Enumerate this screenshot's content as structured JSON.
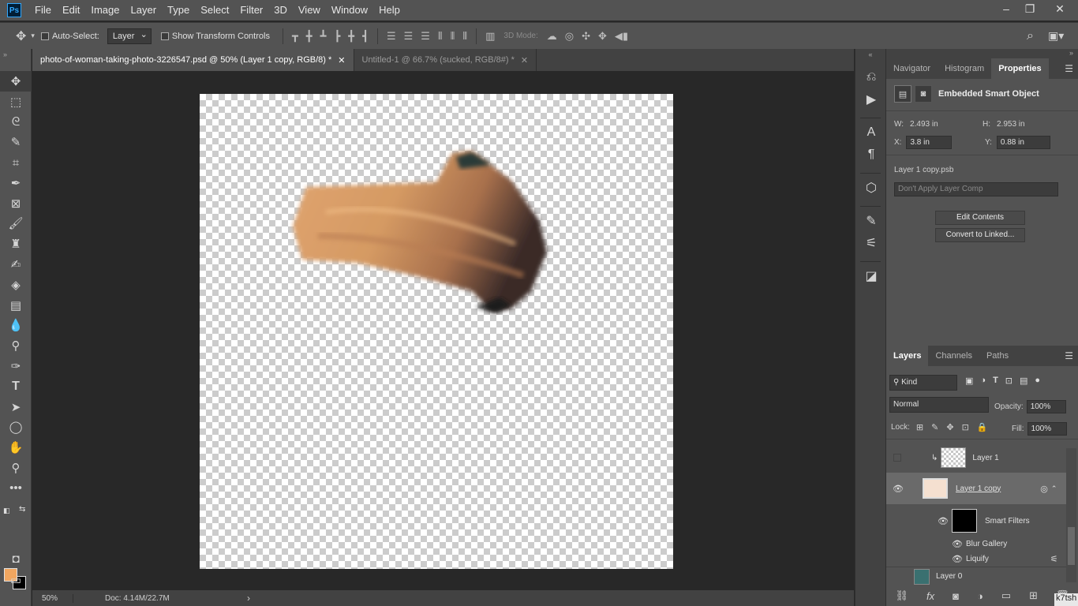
{
  "app": {
    "logo": "Ps",
    "menu": [
      "File",
      "Edit",
      "Image",
      "Layer",
      "Type",
      "Select",
      "Filter",
      "3D",
      "View",
      "Window",
      "Help"
    ],
    "window_controls": {
      "minimize": "–",
      "restore": "❐",
      "close": "✕"
    }
  },
  "options": {
    "auto_select_label": "Auto-Select:",
    "auto_select_value": "Layer",
    "transform_label": "Show Transform Controls",
    "mode_3d_label": "3D Mode:"
  },
  "tabs": [
    {
      "label": "photo-of-woman-taking-photo-3226547.psd @ 50% (Layer 1 copy, RGB/8) *",
      "close": "✕"
    },
    {
      "label": "Untitled-1 @ 66.7% (sucked, RGB/8#) *",
      "close": "✕"
    }
  ],
  "status": {
    "zoom": "50%",
    "doc": "Doc: 4.14M/22.7M",
    "arrow": "›"
  },
  "colors": {
    "foreground": "#f0a660",
    "background": "#000000",
    "accent": "#31a8ff"
  },
  "properties": {
    "tabs": [
      "Navigator",
      "Histogram",
      "Properties"
    ],
    "title": "Embedded Smart Object",
    "w_label": "W:",
    "w_value": "2.493 in",
    "h_label": "H:",
    "h_value": "2.953 in",
    "x_label": "X:",
    "x_value": "3.8 in",
    "y_label": "Y:",
    "y_value": "0.88 in",
    "file": "Layer 1 copy.psb",
    "layer_comp": "Don't Apply Layer Comp",
    "edit_contents": "Edit Contents",
    "convert": "Convert to Linked..."
  },
  "layers": {
    "tabs": [
      "Layers",
      "Channels",
      "Paths"
    ],
    "kind": "Kind",
    "blend_mode": "Normal",
    "opacity_label": "Opacity:",
    "opacity_value": "100%",
    "lock_label": "Lock:",
    "fill_label": "Fill:",
    "fill_value": "100%",
    "items": {
      "layer1": "Layer 1",
      "layer1copy": "Layer 1 copy",
      "smart_filters": "Smart Filters",
      "blur_gallery": "Blur Gallery",
      "liquify": "Liquify",
      "layer0": "Layer 0"
    }
  },
  "watermark": "k7tsh"
}
